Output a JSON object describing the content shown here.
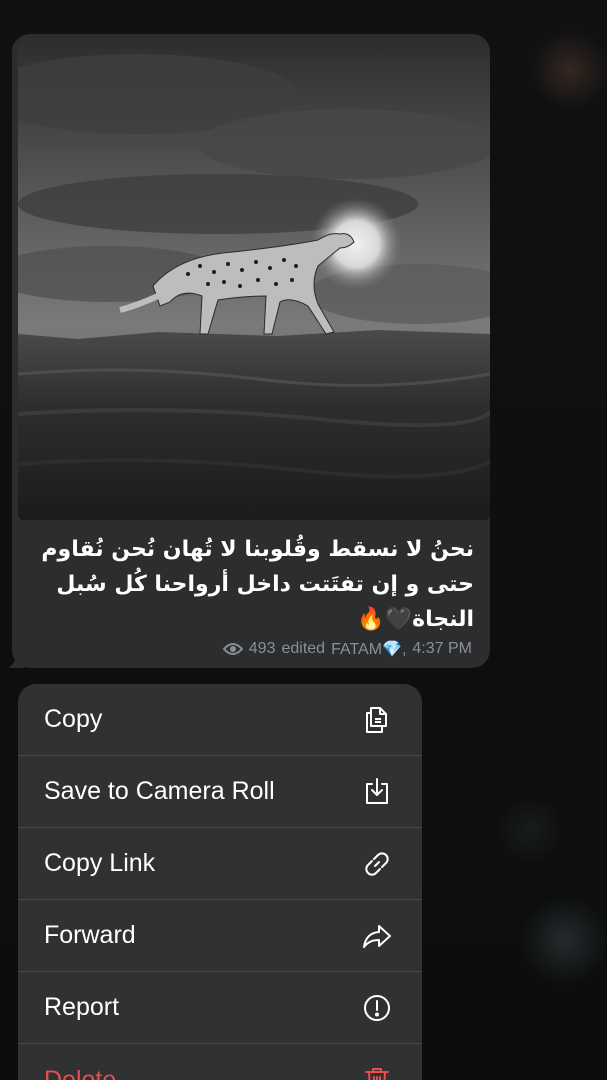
{
  "message": {
    "caption_lines": [
      "نحنُ لا نسقط وقُلوبنا لا تُهان  نُحن نُقاوم",
      "حتى و إن تفتَتت داخل أرواحنا كُل سُبل",
      "النجاة🖤🔥"
    ],
    "views": "493",
    "status": "edited",
    "author": "FATAM💎,",
    "time": "4:37 PM",
    "photo_icon": "cheetah-photo"
  },
  "menu": {
    "items": [
      {
        "label": "Copy",
        "icon": "copy-icon"
      },
      {
        "label": "Save to Camera Roll",
        "icon": "download-icon"
      },
      {
        "label": "Copy Link",
        "icon": "link-icon"
      },
      {
        "label": "Forward",
        "icon": "forward-icon"
      },
      {
        "label": "Report",
        "icon": "report-icon"
      },
      {
        "label": "Delete",
        "icon": "trash-icon"
      }
    ]
  },
  "colors": {
    "bubble": "#2b2d2f",
    "menu": "#2f3133",
    "danger": "#eb4d4b",
    "meta_text": "#8c8f93"
  }
}
